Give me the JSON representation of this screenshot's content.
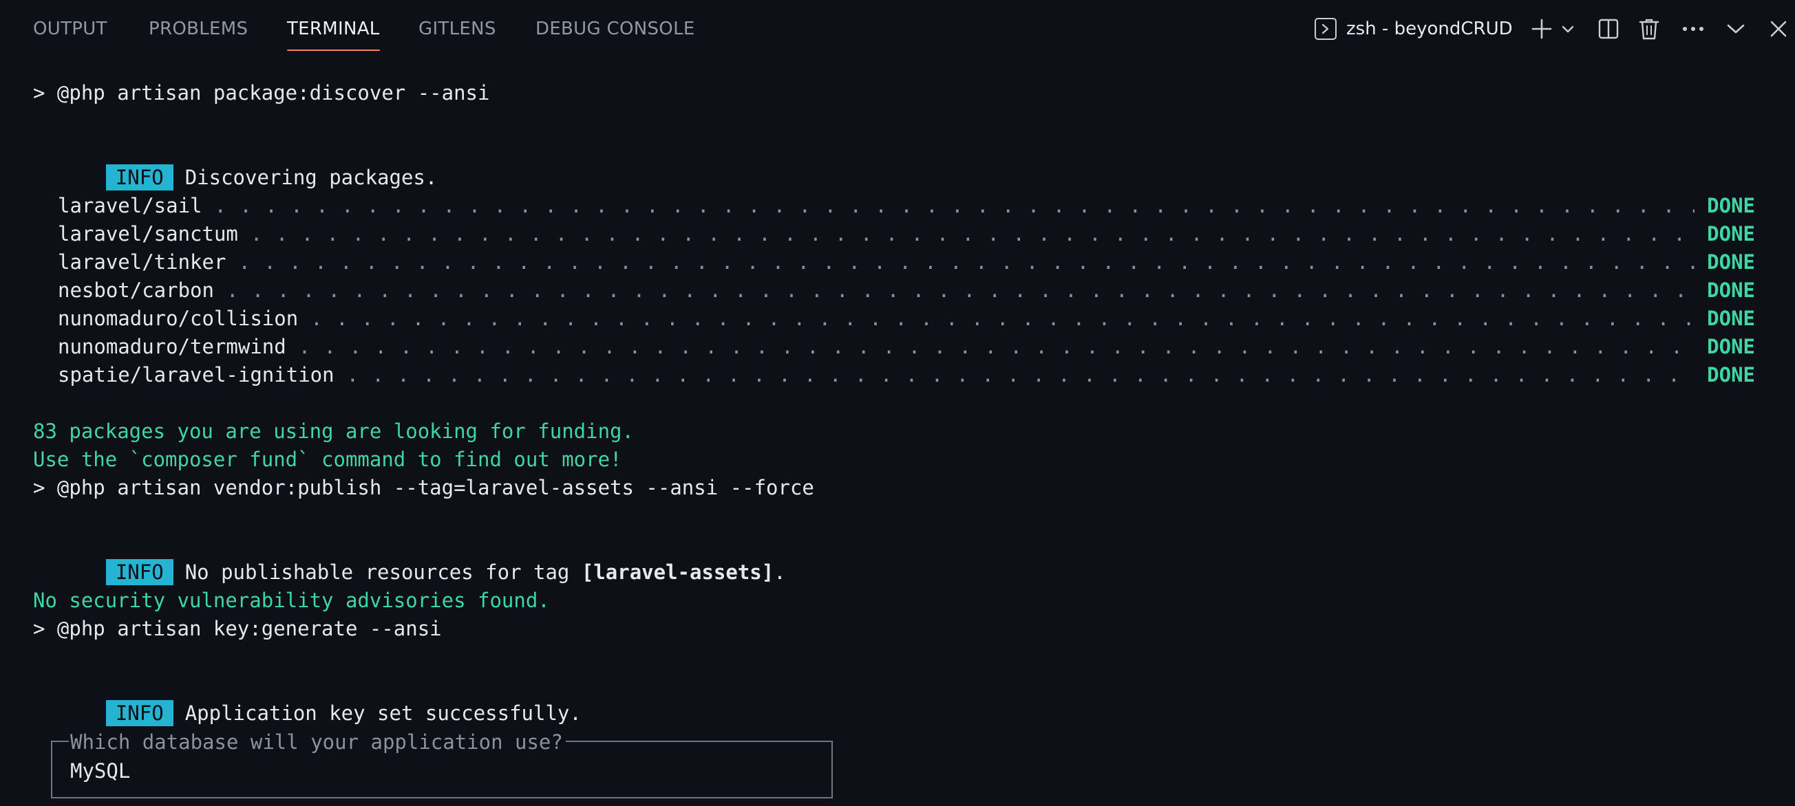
{
  "panel": {
    "tabs": [
      {
        "label": "OUTPUT",
        "active": false
      },
      {
        "label": "PROBLEMS",
        "active": false
      },
      {
        "label": "TERMINAL",
        "active": true
      },
      {
        "label": "GITLENS",
        "active": false
      },
      {
        "label": "DEBUG CONSOLE",
        "active": false
      }
    ],
    "terminal_name": "zsh - beyondCRUD",
    "icons": [
      "terminal-icon",
      "plus-icon",
      "chevron-down-icon",
      "split-icon",
      "trash-icon",
      "more-icon",
      "chevron-down-icon",
      "close-icon"
    ],
    "accent_color": "#f78166"
  },
  "terminal": {
    "cmd_discover": "> @php artisan package:discover --ansi",
    "info_badge": "INFO",
    "info_discovering": "Discovering packages.",
    "packages": [
      {
        "name": "laravel/sail",
        "status": "DONE"
      },
      {
        "name": "laravel/sanctum",
        "status": "DONE"
      },
      {
        "name": "laravel/tinker",
        "status": "DONE"
      },
      {
        "name": "nesbot/carbon",
        "status": "DONE"
      },
      {
        "name": "nunomaduro/collision",
        "status": "DONE"
      },
      {
        "name": "nunomaduro/termwind",
        "status": "DONE"
      },
      {
        "name": "spatie/laravel-ignition",
        "status": "DONE"
      }
    ],
    "funding_line1": "83 packages you are using are looking for funding.",
    "funding_line2": "Use the `composer fund` command to find out more!",
    "cmd_vendor_publish": "> @php artisan vendor:publish --tag=laravel-assets --ansi --force",
    "info_no_publishable_prefix": "No publishable resources for tag ",
    "info_no_publishable_tag": "[laravel-assets]",
    "info_no_publishable_suffix": ".",
    "security_line": "No security vulnerability advisories found.",
    "cmd_key_generate": "> @php artisan key:generate --ansi",
    "info_key_set": "Application key set successfully.",
    "prompt_question": "Which database will your application use?",
    "prompt_answer": "MySQL",
    "colors": {
      "background": "#0d1117",
      "green": "#3fd6a4",
      "info_badge_bg": "#25b3d2",
      "dots": "#8b929a"
    }
  }
}
